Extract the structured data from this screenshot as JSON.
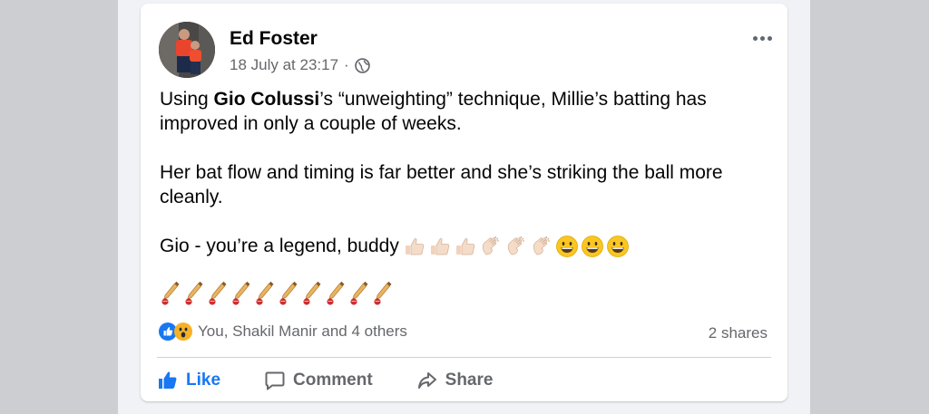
{
  "post": {
    "author": "Ed Foster",
    "timestamp": "18 July at 23:17",
    "separator": "·",
    "paragraph1_author_tag": "Gio Colussi",
    "paragraph1_rest": "’s “unweighting” technique, Millie’s batting has improved in only a couple of weeks.",
    "paragraph1_prefix": "Using ",
    "paragraph2": "Her bat flow and timing is far better and she’s striking the ball more cleanly.",
    "paragraph3": "Gio - you’re a legend, buddy",
    "emoji_sequence": [
      "thumbs-up",
      "thumbs-up",
      "thumbs-up",
      "clapping-hands",
      "clapping-hands",
      "clapping-hands",
      "grinning-face",
      "grinning-face",
      "grinning-face"
    ],
    "cricket_bat_count": 10
  },
  "engagement": {
    "reaction_icons": [
      "like",
      "wow"
    ],
    "reaction_summary": "You, Shakil Manir and 4 others",
    "shares": "2 shares"
  },
  "actions": {
    "like_label": "Like",
    "comment_label": "Comment",
    "share_label": "Share",
    "like_active": true
  },
  "colors": {
    "accent": "#1877f2",
    "secondary_text": "#65676b",
    "primary_text": "#050505",
    "background": "#ccced2"
  }
}
